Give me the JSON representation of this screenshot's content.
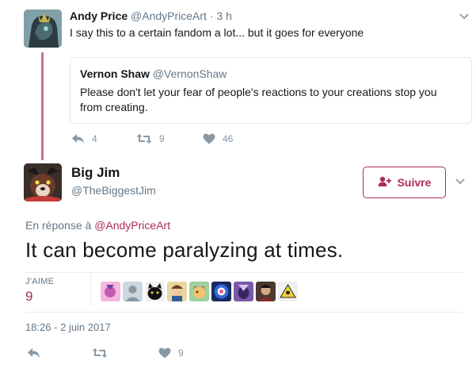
{
  "parent_tweet": {
    "name": "Andy Price",
    "handle": "@AndyPriceArt",
    "separator": "·",
    "time": "3 h",
    "text": "I say this to a certain fandom a lot... but it goes for everyone",
    "quote": {
      "name": "Vernon Shaw",
      "handle": "@VernonShaw",
      "text": "Please don't let your fear of people's reactions to your creations stop you from creating."
    },
    "actions": {
      "reply_icon": "reply-icon",
      "reply_count": "4",
      "retweet_icon": "retweet-icon",
      "retweet_count": "9",
      "like_icon": "heart-icon",
      "like_count": "46"
    }
  },
  "main_tweet": {
    "name": "Big Jim",
    "handle": "@TheBiggestJim",
    "follow_label": "Suivre",
    "reply_prefix": "En réponse à",
    "reply_handle": "@AndyPriceArt",
    "text": "It can become paralyzing at times.",
    "likes_label": "J'AIME",
    "likes_count": "9",
    "timestamp": "18:26 - 2 juin 2017",
    "actions": {
      "reply_icon": "reply-icon",
      "retweet_icon": "retweet-icon",
      "like_icon": "heart-icon",
      "like_count": "9"
    }
  },
  "colors": {
    "accent": "#ac2c54",
    "thread_line": "#c37189",
    "muted": "#657786",
    "icon": "#8899a6"
  }
}
